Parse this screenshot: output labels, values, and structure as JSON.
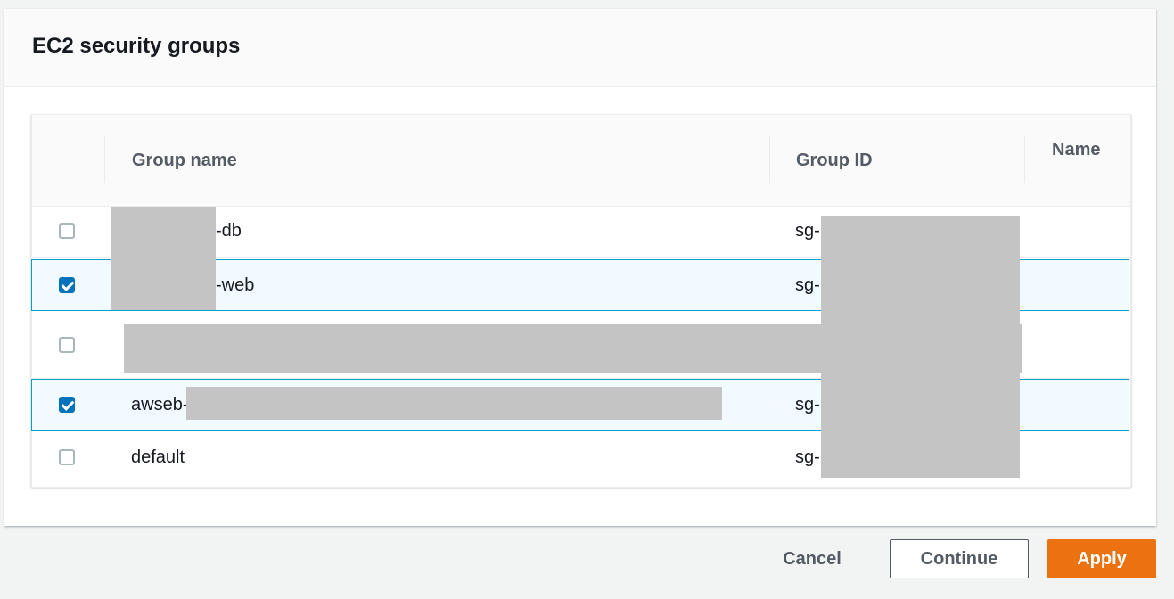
{
  "panel": {
    "title": "EC2 security groups"
  },
  "table": {
    "columns": [
      "Group name",
      "Group ID",
      "Name"
    ],
    "rows": [
      {
        "name": "-db",
        "group_id": "sg-",
        "tag_name": "",
        "checked": false
      },
      {
        "name": "-web",
        "group_id": "sg-",
        "tag_name": "",
        "checked": true
      },
      {
        "name": "",
        "group_id": "",
        "tag_name": "",
        "checked": false
      },
      {
        "name": "awseb-",
        "group_id": "sg-",
        "tag_name": "",
        "checked": true
      },
      {
        "name": "default",
        "group_id": "sg-",
        "tag_name": "",
        "checked": false
      }
    ]
  },
  "footer": {
    "cancel_label": "Cancel",
    "continue_label": "Continue",
    "apply_label": "Apply"
  },
  "colors": {
    "accent": "#0073bb",
    "primary_button": "#ec7211",
    "selected_row_bg": "#f1faff",
    "selected_row_border": "#00a1c9"
  }
}
